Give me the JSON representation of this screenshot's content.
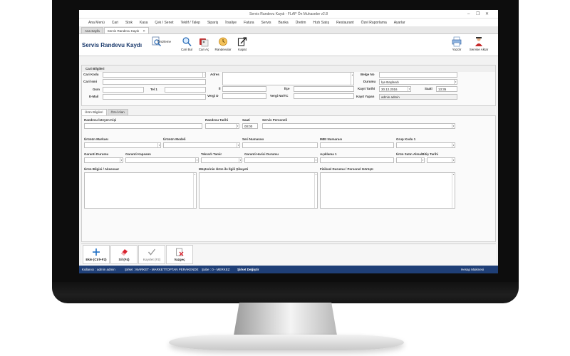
{
  "window": {
    "title": "Servis Randevu Kaydı - FLAP Ön Muhasebe v2.8",
    "minimize": "–",
    "restore": "❐",
    "close": "✕"
  },
  "menu": [
    "Ana Menü",
    "Cari",
    "Stok",
    "Kasa",
    "Çek / Senet",
    "Teklif / Talep",
    "Sipariş",
    "İrsaliye",
    "Fatura",
    "Servis",
    "Banka",
    "Üretim",
    "Hızlı Satış",
    "Restaurant",
    "Özel Raporlama",
    "Ayarlar"
  ],
  "tabs": {
    "home": "Ana Sayfa",
    "current": "Servis Randevu Kaydı",
    "close": "✕"
  },
  "toolbar": {
    "page_title": "Servis Randevu Kaydı",
    "preview": "Önizleme",
    "cari_bul": "Cari Bul",
    "cari_ac": "Cari Aç",
    "randevular": "Randevular",
    "kapat": "Kapat",
    "yazdir": "Yazdır",
    "servise_aktar": "Servise Aktar"
  },
  "cari": {
    "section": "Cari Bilgileri",
    "cari_kodu": "Cari Kodu",
    "cari_ismi": "Cari İsmi",
    "gsm": "Gsm",
    "tel1": "Tel 1",
    "email": "E-Mail",
    "adres": "Adres",
    "il": "İl",
    "ilce": "İlçe",
    "vergi_d": "Vergi D",
    "vergi_no": "Vergi No/TC",
    "belge_no": "Belge No",
    "durumu": "Durumu",
    "durumu_value": "İşe Başlandı",
    "kayit_tarihi": "Kayıt Tarihi",
    "kayit_tarihi_value": "30.12.2016",
    "saati": "Saati",
    "saati_value": "13:35",
    "kayit_yapan": "Kayıt Yapan",
    "kayit_yapan_value": "admin admin"
  },
  "inner_tabs": {
    "urun": "Ürün Bilgileri",
    "ozel": "Özel Alan"
  },
  "urun": {
    "randevu_isteyen": "Randevu İsteyen Kişi",
    "randevu_tarihi": "Randevu Tarihi",
    "saati": "Saati",
    "saati_value": "00:00",
    "servis_personeli": "Servis Personeli",
    "urun_markasi": "Ürünün Markası",
    "urun_modeli": "Ürünün Modeli",
    "seri_numarasi": "Seri Numarası",
    "imei": "IMEI Numarası",
    "grup_kodu": "Grup Kodu 1",
    "garanti_durumu": "Garanti Durumu",
    "garanti_kapsami": "Garanti Kapsamı",
    "tekrarli_tamir": "Tekrarlı Tamir",
    "garanti_harici": "Garanti Harici Durumu",
    "aciklama": "Açıklama 1",
    "satin_alma": "Ürün Satın Alma/Bitiş Tarihi",
    "aksesuar": "Ürün Bilgisi / Aksesuar",
    "sikayet": "Müşterinin Ürün ile İlgili Şikayeti",
    "fiziksel": "Fiziksel Durumu / Personel Görüşü"
  },
  "actions": {
    "ekle": "Ekle (Ctrl+F2)",
    "sil": "Sil (F4)",
    "kaydet": "Kaydet (F2)",
    "vazgec": "Vazgeç"
  },
  "status": {
    "kullanici": "Kullanıcı : admin admin",
    "sirket": "Şirket : MARKET - MARKETTOPTAN PERAKENDE",
    "sube": "Şube : 0 - MERKEZ",
    "degistir": "Şirket Değiştir",
    "hesap": "Hesap Makinesi"
  },
  "colors": {
    "accent": "#1f3f77",
    "title_text": "#1d3c6e",
    "add_icon": "#1f6fc5",
    "delete_icon": "#d9232e"
  }
}
